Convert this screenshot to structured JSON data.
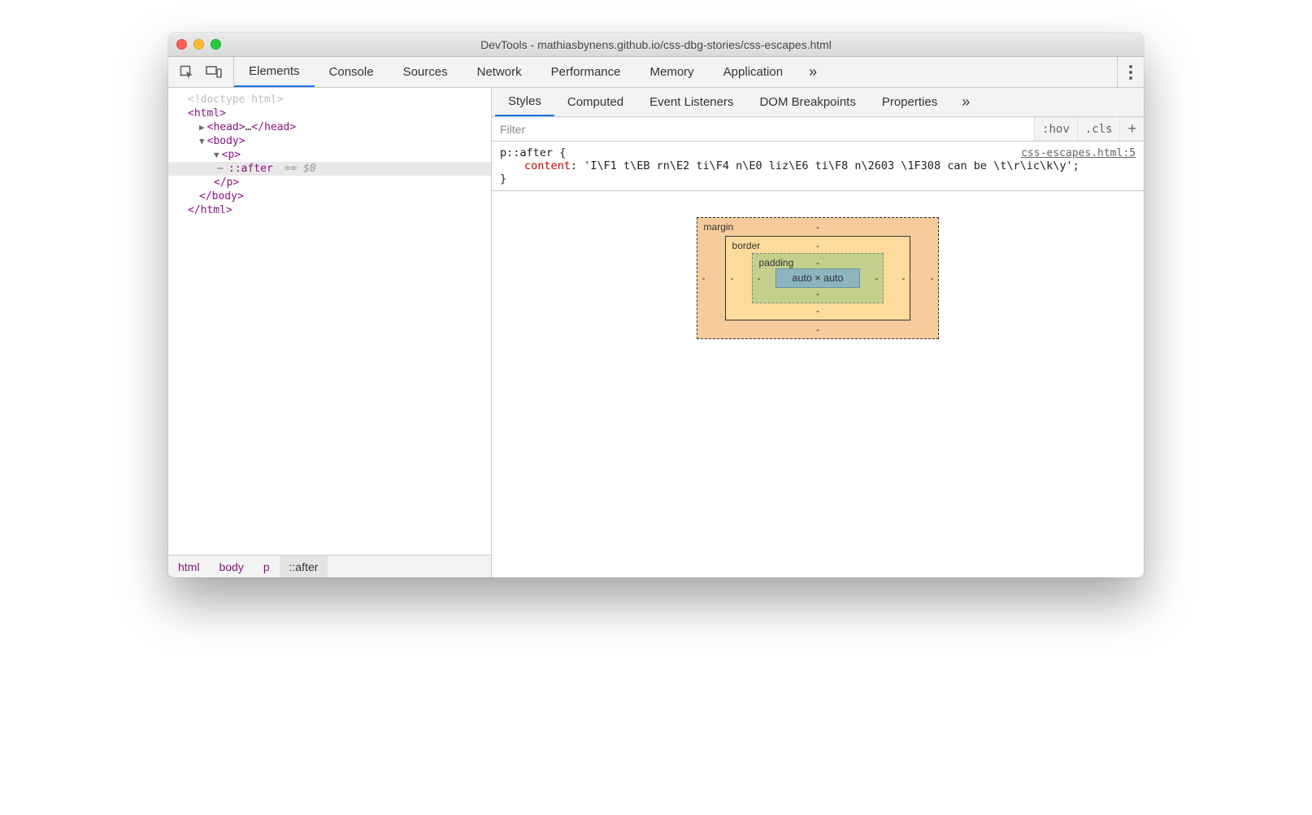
{
  "titlebar": {
    "title": "DevTools - mathiasbynens.github.io/css-dbg-stories/css-escapes.html"
  },
  "main_tabs": {
    "items": [
      "Elements",
      "Console",
      "Sources",
      "Network",
      "Performance",
      "Memory",
      "Application"
    ],
    "active": 0,
    "more": "»"
  },
  "dom": {
    "lines": [
      {
        "gutter": "",
        "indent": 0,
        "cls": "gray",
        "text": "<!doctype html>"
      },
      {
        "gutter": "",
        "indent": 0,
        "cls": "tag",
        "text": "<html>"
      },
      {
        "gutter": "",
        "indent": 1,
        "disclosure": "▶",
        "cls": "tag",
        "text": "<head>…</head>"
      },
      {
        "gutter": "",
        "indent": 1,
        "disclosure": "▼",
        "cls": "tag",
        "text": "<body>"
      },
      {
        "gutter": "",
        "indent": 2,
        "disclosure": "▼",
        "cls": "tag",
        "text": "<p>"
      },
      {
        "gutter": "⋯",
        "indent": 3,
        "cls": "pseudo selected",
        "text": "::after",
        "suffix": " == $0"
      },
      {
        "gutter": "",
        "indent": 2,
        "cls": "tag",
        "text": "</p>"
      },
      {
        "gutter": "",
        "indent": 1,
        "cls": "tag",
        "text": "</body>"
      },
      {
        "gutter": "",
        "indent": 0,
        "cls": "tag",
        "text": "</html>"
      }
    ]
  },
  "crumbs": [
    "html",
    "body",
    "p",
    "::after"
  ],
  "sub_tabs": {
    "items": [
      "Styles",
      "Computed",
      "Event Listeners",
      "DOM Breakpoints",
      "Properties"
    ],
    "active": 0,
    "more": "»"
  },
  "filter": {
    "placeholder": "Filter",
    "hov": ":hov",
    "cls": ".cls",
    "plus": "+"
  },
  "rule": {
    "selector": "p::after {",
    "source": "css-escapes.html:5",
    "prop": "content",
    "value": "'I\\F1 t\\EB rn\\E2 ti\\F4 n\\E0 liz\\E6 ti\\F8 n\\2603 \\1F308 can be \\t\\r\\ic\\k\\y'",
    "close": "}"
  },
  "boxmodel": {
    "margin_label": "margin",
    "border_label": "border",
    "padding_label": "padding",
    "dash": "-",
    "content": "auto × auto"
  }
}
